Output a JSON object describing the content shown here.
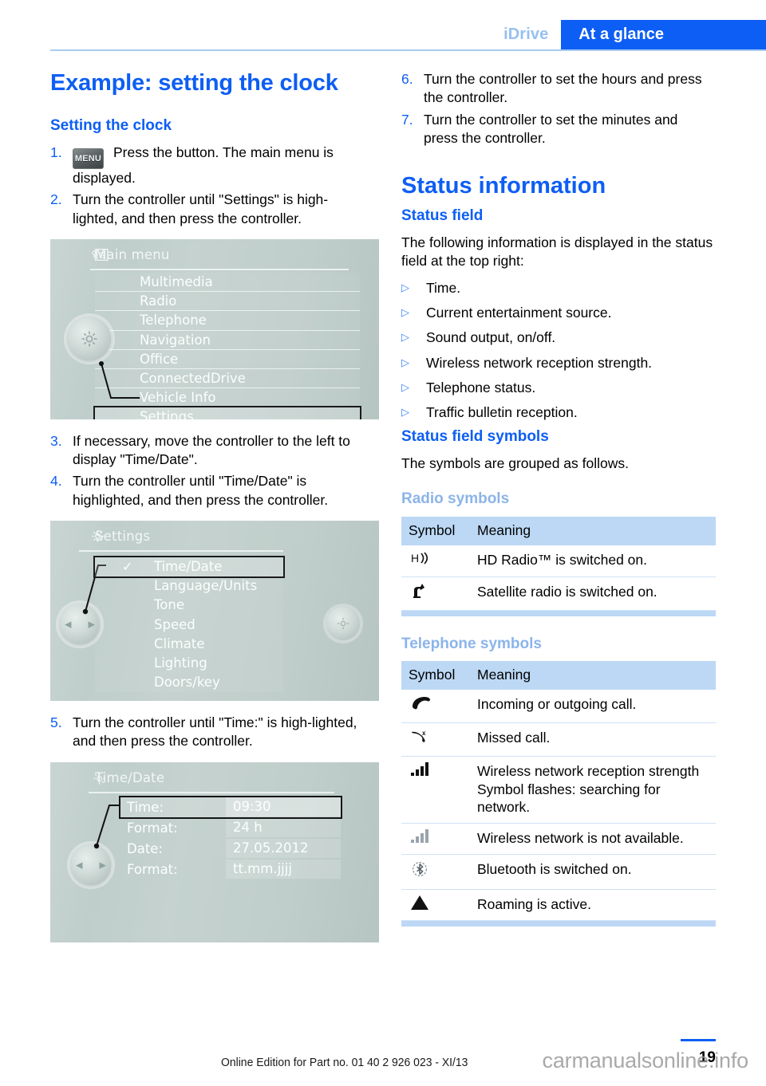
{
  "header": {
    "chapter": "iDrive",
    "section": "At a glance"
  },
  "left_column": {
    "title": "Example: setting the clock",
    "subtitle": "Setting the clock",
    "steps": [
      {
        "num": "1.",
        "icon": "MENU",
        "text": "Press the button. The main menu is displayed."
      },
      {
        "num": "2.",
        "text": "Turn the controller until \"Settings\" is high-lighted, and then press the controller."
      },
      {
        "num": "3.",
        "text": "If necessary, move the controller to the left to display \"Time/Date\"."
      },
      {
        "num": "4.",
        "text": "Turn the controller until \"Time/Date\" is highlighted, and then press the controller."
      },
      {
        "num": "5.",
        "text": "Turn the controller until \"Time:\" is high-lighted, and then press the controller."
      }
    ],
    "screens": {
      "main_menu": {
        "title": "Main menu",
        "icon": "list-card-icon",
        "items": [
          {
            "label": "Multimedia",
            "selected": false
          },
          {
            "label": "Radio",
            "selected": false
          },
          {
            "label": "Telephone",
            "selected": false
          },
          {
            "label": "Navigation",
            "selected": false
          },
          {
            "label": "Office",
            "selected": false
          },
          {
            "label": "ConnectedDrive",
            "selected": false
          },
          {
            "label": "Vehicle Info",
            "selected": false
          },
          {
            "label": "Settings",
            "selected": true
          }
        ]
      },
      "settings": {
        "title": "Settings",
        "icon": "gear-icon",
        "items": [
          {
            "label": "Time/Date",
            "selected": true,
            "checked": true
          },
          {
            "label": "Language/Units",
            "selected": false,
            "checked": false
          },
          {
            "label": "Tone",
            "selected": false,
            "checked": false
          },
          {
            "label": "Speed",
            "selected": false,
            "checked": false
          },
          {
            "label": "Climate",
            "selected": false,
            "checked": false
          },
          {
            "label": "Lighting",
            "selected": false,
            "checked": false
          },
          {
            "label": "Doors/key",
            "selected": false,
            "checked": false
          }
        ]
      },
      "time_date": {
        "title": "Time/Date",
        "icon": "gear-stack-icon",
        "rows": [
          {
            "label": "Time:",
            "value": "09:30",
            "selected": true
          },
          {
            "label": "Format:",
            "value": "24 h",
            "selected": false
          },
          {
            "label": "Date:",
            "value": "27.05.2012",
            "selected": false
          },
          {
            "label": "Format:",
            "value": "tt.mm.jjjj",
            "selected": false
          }
        ]
      }
    }
  },
  "right_column": {
    "steps": [
      {
        "num": "6.",
        "text": "Turn the controller to set the hours and press the controller."
      },
      {
        "num": "7.",
        "text": "Turn the controller to set the minutes and press the controller."
      }
    ],
    "status_information_title": "Status information",
    "status_field": {
      "heading": "Status field",
      "intro": "The following information is displayed in the status field at the top right:",
      "bullets": [
        "Time.",
        "Current entertainment source.",
        "Sound output, on/off.",
        "Wireless network reception strength.",
        "Telephone status.",
        "Traffic bulletin reception."
      ]
    },
    "status_field_symbols": {
      "heading": "Status field symbols",
      "intro": "The symbols are grouped as follows."
    },
    "radio_symbols": {
      "heading": "Radio symbols",
      "columns": [
        "Symbol",
        "Meaning"
      ],
      "rows": [
        {
          "symbol": "hd-radio-icon",
          "meaning": "HD Radio™ is switched on."
        },
        {
          "symbol": "satellite-radio-icon",
          "meaning": "Satellite radio is switched on."
        }
      ]
    },
    "telephone_symbols": {
      "heading": "Telephone symbols",
      "columns": [
        "Symbol",
        "Meaning"
      ],
      "rows": [
        {
          "symbol": "handset-icon",
          "meaning": "Incoming or outgoing call."
        },
        {
          "symbol": "missed-call-icon",
          "meaning": "Missed call."
        },
        {
          "symbol": "signal-bars-icon",
          "meaning": "Wireless network reception strength Symbol flashes: searching for network."
        },
        {
          "symbol": "signal-bars-off-icon",
          "meaning": "Wireless network is not available."
        },
        {
          "symbol": "bluetooth-icon",
          "meaning": "Bluetooth is switched on."
        },
        {
          "symbol": "roaming-triangle-icon",
          "meaning": "Roaming is active."
        }
      ]
    }
  },
  "footer": {
    "note": "Online Edition for Part no. 01 40 2 926 023 - XI/13",
    "watermark": "carmanualsonline.info",
    "page_number": "19"
  },
  "colors": {
    "accent_blue": "#0d5ef4",
    "light_blue_heading": "#8bb4ea",
    "table_header_bg": "#bcd8f5",
    "header_rule": "#a9cbf0"
  }
}
